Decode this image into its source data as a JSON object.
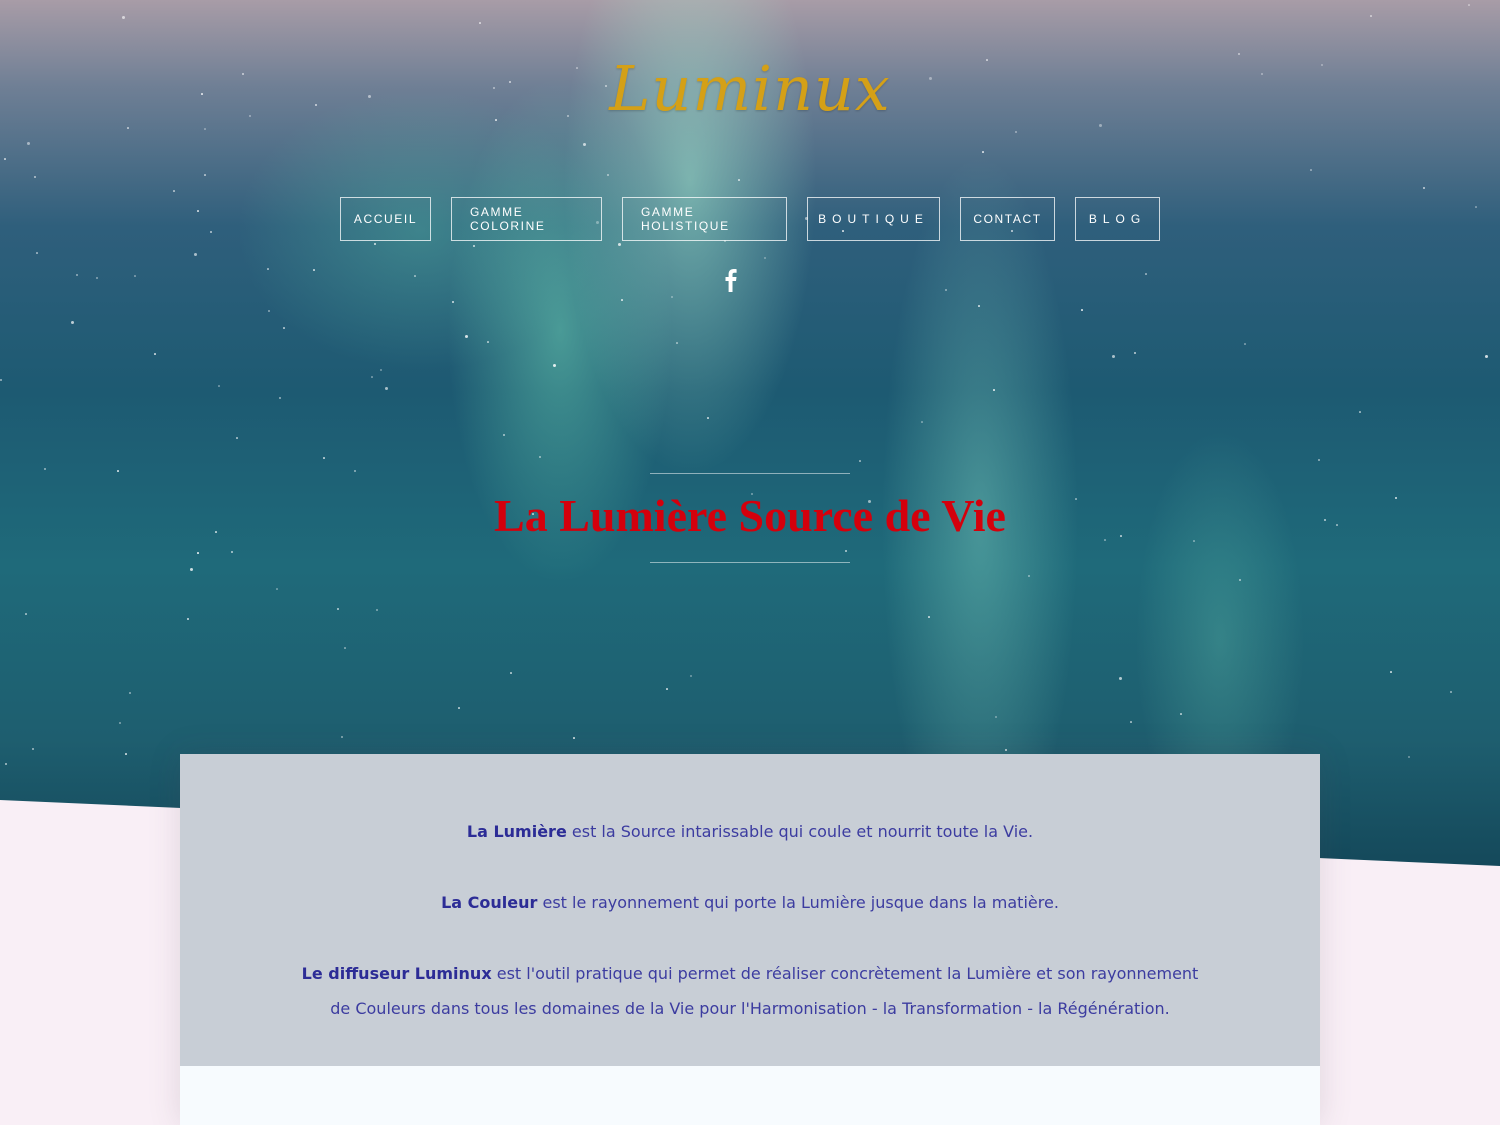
{
  "logo": {
    "text": "Luminux"
  },
  "nav": {
    "items": [
      {
        "label": "ACCUEIL"
      },
      {
        "label": "GAMME COLORINE"
      },
      {
        "label": "GAMME HOLISTIQUE"
      },
      {
        "label": "BOUTIQUE"
      },
      {
        "label": "CONTACT"
      },
      {
        "label": "BLOG"
      }
    ]
  },
  "social": {
    "icon": "facebook-icon"
  },
  "hero": {
    "title": "La Lumière Source de Vie"
  },
  "intro": {
    "p1_bold": "La Lumière",
    "p1_rest": " est la Source intarissable qui coule et nourrit toute la Vie.",
    "p2_bold": "La Couleur",
    "p2_rest": " est le rayonnement qui porte la Lumière jusque dans la matière.",
    "p3_bold": "Le diffuseur Luminux",
    "p3_rest_line1": " est l'outil pratique qui permet de réaliser concrètement la Lumière et son rayonnement",
    "p3_rest_line2": "de Couleurs dans tous les domaines de la Vie pour l'Harmonisation - la Transformation - la Régénération."
  },
  "colors": {
    "accent_title": "#d4000c",
    "logo_gold": "#d4a017",
    "text_blue": "#3c3ca0",
    "card_bg": "#c8ced6"
  }
}
